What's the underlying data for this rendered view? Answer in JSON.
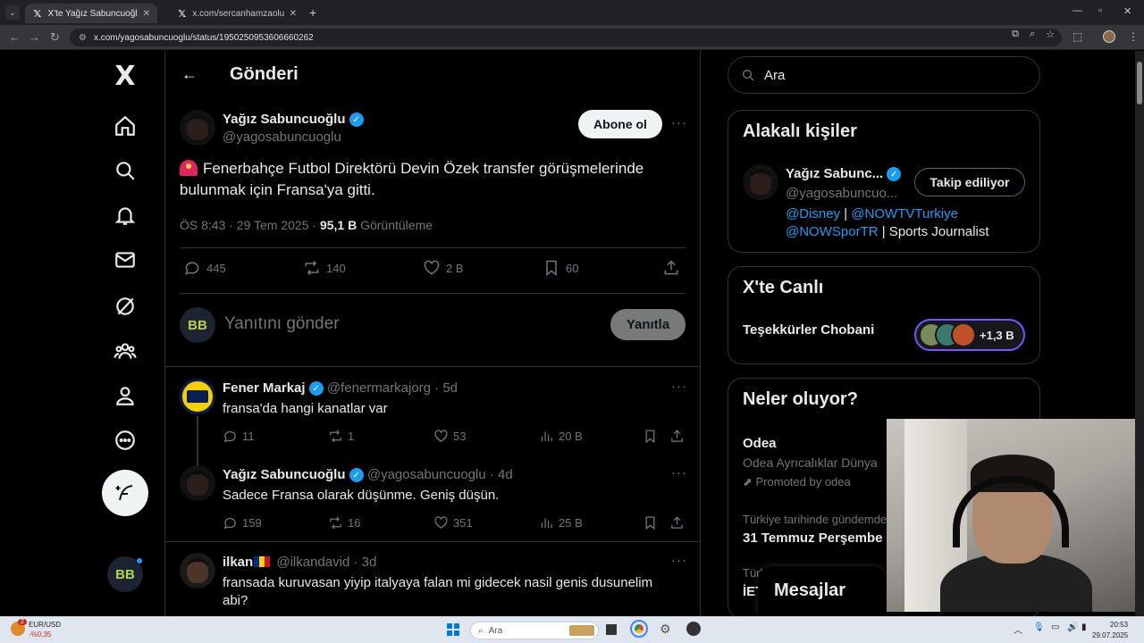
{
  "browser": {
    "tabs": [
      {
        "title": "X'te Yağız Sabuncuoğlu \"🚨 Fe",
        "active": true
      },
      {
        "title": "x.com/sercanhamzaolu/status/",
        "active": false
      }
    ],
    "url": "x.com/yagosabuncuoglu/status/1950250953606660262"
  },
  "nav": {
    "logo": "X"
  },
  "header": {
    "title": "Gönderi"
  },
  "tweet": {
    "author_name": "Yağız Sabuncuoğlu",
    "author_handle": "@yagosabuncuoglu",
    "subscribe_label": "Abone ol",
    "text": "Fenerbahçe Futbol Direktörü Devin Özek transfer görüşmelerinde bulunmak için Fransa'ya gitti.",
    "time": "ÖS 8:43 · 29 Tem 2025 · ",
    "views_count": "95,1 B",
    "views_label": " Görüntüleme",
    "stats": {
      "replies": "445",
      "reposts": "140",
      "likes": "2 B",
      "bookmarks": "60"
    }
  },
  "compose": {
    "placeholder": "Yanıtını gönder",
    "reply_label": "Yanıtla",
    "avatar_text": "BB"
  },
  "replies": [
    {
      "name": "Fener Markaj",
      "handle": "@fenermarkajorg",
      "age": " · 5d",
      "text": "fransa'da hangi kanatlar var",
      "replies": "11",
      "reposts": "1",
      "likes": "53",
      "views": "20 B"
    },
    {
      "name": "Yağız Sabuncuoğlu",
      "handle": "@yagosabuncuoglu",
      "age": " · 4d",
      "text": "Sadece Fransa olarak düşünme. Geniş düşün.",
      "replies": "159",
      "reposts": "16",
      "likes": "351",
      "views": "25 B"
    },
    {
      "name": "ilkan",
      "handle": "@ilkandavid",
      "age": " · 3d",
      "text": "fransada kuruvasan yiyip italyaya falan mi gidecek nasil genis dusunelim abi?"
    }
  ],
  "sidebar": {
    "search_placeholder": "Ara",
    "related": {
      "title": "Alakalı kişiler",
      "name": "Yağız Sabunc...",
      "handle": "@yagosabuncuo...",
      "follow_label": "Takip ediliyor",
      "bio_link1": "@Disney",
      "bio_sep": " | ",
      "bio_link2": "@NOWTVTurkiye",
      "bio_link3": "@NOWSporTR",
      "bio_tail": " | Sports Journalist"
    },
    "live": {
      "title": "X'te Canlı",
      "space": "Teşekkürler Chobani",
      "listeners": "+1,3 B"
    },
    "trends": {
      "title": "Neler oluyor?",
      "promo_title": "Odea",
      "promo_sub": "Odea Ayrıcalıklar Dünya",
      "promo_by": "Promoted by odea",
      "t2_context": "Türkiye tarihinde gündemde",
      "t2_title": "31 Temmuz Perşembe",
      "t3_context": "Türk",
      "t3_title": "İET"
    }
  },
  "messages": {
    "label": "Mesajlar"
  },
  "taskbar": {
    "ticker": "EUR/USD",
    "ticker_change": "-%0,35",
    "badge": "2",
    "search_placeholder": "Ara",
    "time": "20:53",
    "date": "29.07.2025"
  }
}
